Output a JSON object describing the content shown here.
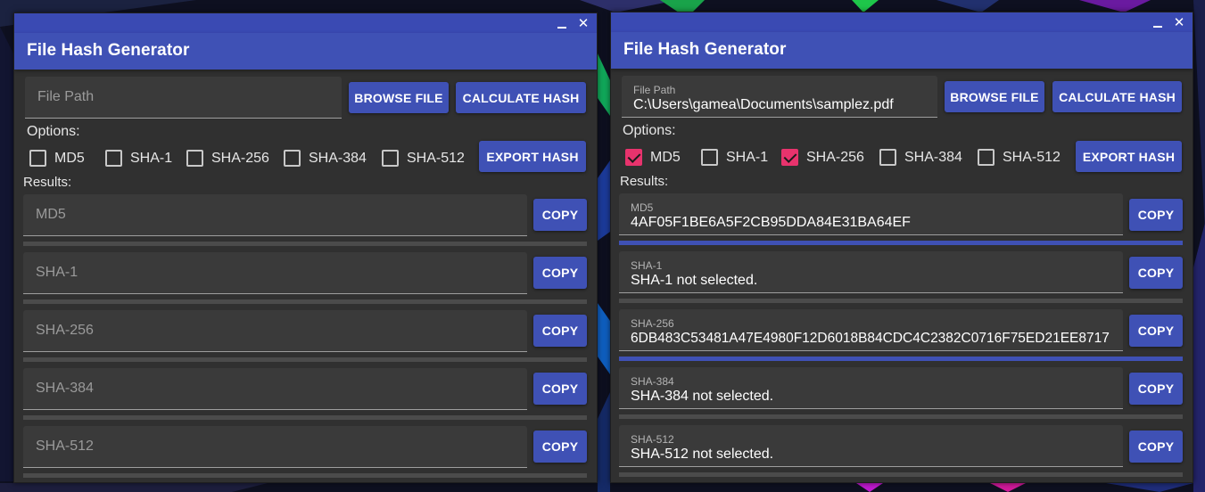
{
  "windows": [
    {
      "title": "File Hash Generator",
      "file_path": {
        "placeholder": "File Path",
        "label": "",
        "value": ""
      },
      "browse_label": "BROWSE FILE",
      "calculate_label": "CALCULATE HASH",
      "options_label": "Options:",
      "options": [
        {
          "label": "MD5",
          "checked": false
        },
        {
          "label": "SHA-1",
          "checked": false
        },
        {
          "label": "SHA-256",
          "checked": false
        },
        {
          "label": "SHA-384",
          "checked": false
        },
        {
          "label": "SHA-512",
          "checked": false
        }
      ],
      "export_label": "EXPORT HASH",
      "results_label": "Results:",
      "results": [
        {
          "placeholder": "MD5",
          "label": "",
          "value": "",
          "copy": "COPY",
          "progress": 0
        },
        {
          "placeholder": "SHA-1",
          "label": "",
          "value": "",
          "copy": "COPY",
          "progress": 0
        },
        {
          "placeholder": "SHA-256",
          "label": "",
          "value": "",
          "copy": "COPY",
          "progress": 0
        },
        {
          "placeholder": "SHA-384",
          "label": "",
          "value": "",
          "copy": "COPY",
          "progress": 0
        },
        {
          "placeholder": "SHA-512",
          "label": "",
          "value": "",
          "copy": "COPY",
          "progress": 0
        }
      ]
    },
    {
      "title": "File Hash Generator",
      "file_path": {
        "placeholder": "",
        "label": "File Path",
        "value": "C:\\Users\\gamea\\Documents\\samplez.pdf"
      },
      "browse_label": "BROWSE FILE",
      "calculate_label": "CALCULATE HASH",
      "options_label": "Options:",
      "options": [
        {
          "label": "MD5",
          "checked": true
        },
        {
          "label": "SHA-1",
          "checked": false
        },
        {
          "label": "SHA-256",
          "checked": true
        },
        {
          "label": "SHA-384",
          "checked": false
        },
        {
          "label": "SHA-512",
          "checked": false
        }
      ],
      "export_label": "EXPORT HASH",
      "results_label": "Results:",
      "results": [
        {
          "placeholder": "",
          "label": "MD5",
          "value": "4AF05F1BE6A5F2CB95DDA84E31BA64EF",
          "copy": "COPY",
          "progress": 1
        },
        {
          "placeholder": "",
          "label": "SHA-1",
          "value": "SHA-1 not selected.",
          "copy": "COPY",
          "progress": 0
        },
        {
          "placeholder": "",
          "label": "SHA-256",
          "value": "6DB483C53481A47E4980F12D6018B84CDC4C2382C0716F75ED21EE8717",
          "copy": "COPY",
          "progress": 1
        },
        {
          "placeholder": "",
          "label": "SHA-384",
          "value": "SHA-384 not selected.",
          "copy": "COPY",
          "progress": 0
        },
        {
          "placeholder": "",
          "label": "SHA-512",
          "value": "SHA-512 not selected.",
          "copy": "COPY",
          "progress": 0
        }
      ]
    }
  ],
  "colors": {
    "accent": "#3f51b5",
    "check": "#e8336d",
    "surface": "#303030",
    "field": "#3a3a3a"
  }
}
